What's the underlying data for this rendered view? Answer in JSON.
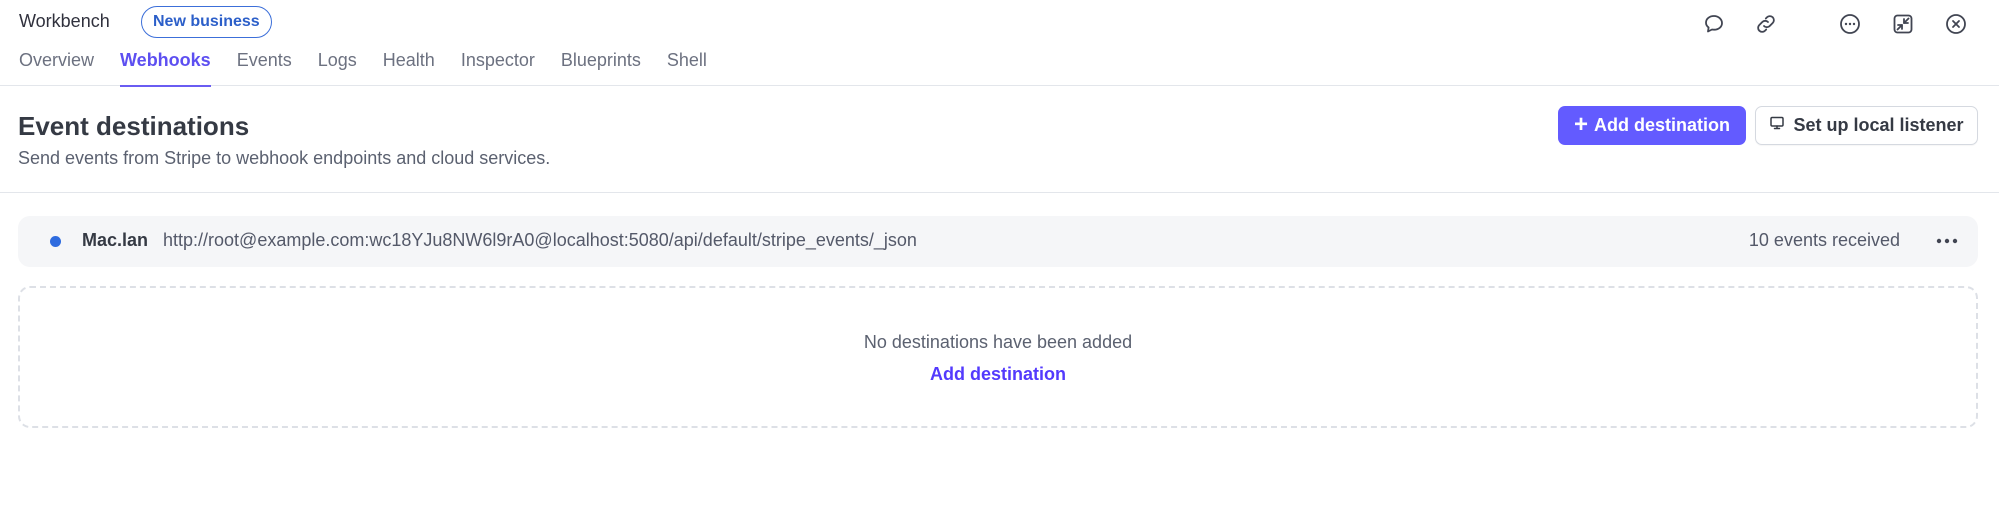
{
  "app": {
    "title": "Workbench",
    "environment_badge": "New business"
  },
  "tabs": [
    {
      "label": "Overview",
      "active": false
    },
    {
      "label": "Webhooks",
      "active": true
    },
    {
      "label": "Events",
      "active": false
    },
    {
      "label": "Logs",
      "active": false
    },
    {
      "label": "Health",
      "active": false
    },
    {
      "label": "Inspector",
      "active": false
    },
    {
      "label": "Blueprints",
      "active": false
    },
    {
      "label": "Shell",
      "active": false
    }
  ],
  "top_icons": [
    "chat-icon",
    "link-icon",
    "more-circle-icon",
    "collapse-icon",
    "close-circle-icon"
  ],
  "header": {
    "title": "Event destinations",
    "subtitle": "Send events from Stripe to webhook endpoints and cloud services.",
    "add_button_label": "Add destination",
    "local_listener_label": "Set up local listener"
  },
  "destinations": [
    {
      "name": "Mac.lan",
      "url": "http://root@example.com:wc18YJu8NW6l9rA0@localhost:5080/api/default/stripe_events/_json",
      "events": "10 events received",
      "status_color": "#2e6bdf"
    }
  ],
  "empty_state": {
    "message": "No destinations have been added",
    "link_label": "Add destination"
  },
  "colors": {
    "accent": "#635bff",
    "active_tab": "#5d4ff1",
    "link": "#533afd",
    "badge": "#2c5fc9"
  }
}
